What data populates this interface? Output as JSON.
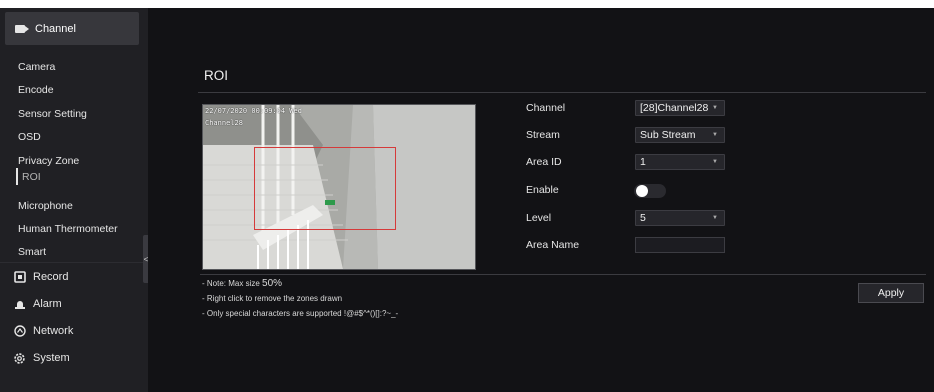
{
  "sidebar": {
    "header_label": "Channel",
    "channel_items": [
      {
        "label": "Camera"
      },
      {
        "label": "Encode"
      },
      {
        "label": "Sensor Setting"
      },
      {
        "label": "OSD"
      },
      {
        "label": "Privacy Zone"
      },
      {
        "label": "ROI",
        "active": true
      },
      {
        "label": "Microphone"
      },
      {
        "label": "Human Thermometer"
      },
      {
        "label": "Smart"
      }
    ],
    "groups": [
      {
        "label": "Record",
        "icon": "record-icon"
      },
      {
        "label": "Alarm",
        "icon": "alarm-icon"
      },
      {
        "label": "Network",
        "icon": "network-icon"
      },
      {
        "label": "System",
        "icon": "system-gear-icon"
      }
    ],
    "collapse_glyph": "<"
  },
  "main": {
    "title": "ROI",
    "video": {
      "osd_datetime": "22/07/2020 00:09:04 Wed",
      "osd_channel": "Channel28"
    },
    "form": {
      "channel": {
        "label": "Channel",
        "value": "[28]Channel28"
      },
      "stream": {
        "label": "Stream",
        "value": "Sub Stream"
      },
      "area_id": {
        "label": "Area ID",
        "value": "1"
      },
      "enable": {
        "label": "Enable",
        "value": "on"
      },
      "level": {
        "label": "Level",
        "value": "5"
      },
      "area_name": {
        "label": "Area Name",
        "value": ""
      }
    },
    "notes": [
      {
        "prefix": "- Note: Max size ",
        "emphasis": "50%"
      },
      {
        "prefix": "- Right click to remove the zones drawn",
        "emphasis": ""
      },
      {
        "prefix": "- Only special characters are supported !@#$^*()[]:?~_-",
        "emphasis": ""
      }
    ],
    "apply_label": "Apply"
  },
  "colors": {
    "background": "#121215",
    "sidebar": "#202024",
    "roi_rect": "#d53a3a"
  }
}
